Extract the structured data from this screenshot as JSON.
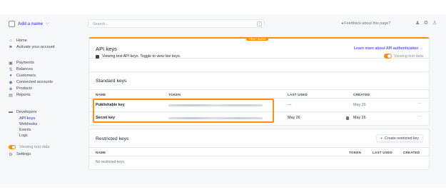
{
  "account": {
    "name": "Add a name",
    "chevron": "chevron-down-icon"
  },
  "sidebar": {
    "items": [
      {
        "label": "Home",
        "icon": "home-icon"
      },
      {
        "label": "Activate your account",
        "icon": "activate-icon"
      },
      {
        "label": "Payments",
        "icon": "payments-icon"
      },
      {
        "label": "Balances",
        "icon": "balances-icon"
      },
      {
        "label": "Customers",
        "icon": "customers-icon"
      },
      {
        "label": "Connected accounts",
        "icon": "connected-accounts-icon"
      },
      {
        "label": "Products",
        "icon": "products-icon"
      },
      {
        "label": "Reports",
        "icon": "reports-icon"
      },
      {
        "label": "Developers",
        "icon": "developers-icon"
      }
    ],
    "developer_sub": [
      "API keys",
      "Webhooks",
      "Events",
      "Logs"
    ],
    "test_toggle_label": "Viewing test data",
    "settings_label": "Settings"
  },
  "header": {
    "search_placeholder": "Search...",
    "search_shortcut": "/",
    "feedback": "Feedback about this page?"
  },
  "api_keys": {
    "badge": "TEST DATA",
    "title": "API keys",
    "learn_more": "Learn more about API authentication →",
    "notice": "Viewing test API keys. Toggle to view live keys.",
    "viewing_test": "Viewing test data"
  },
  "standard_keys": {
    "title": "Standard keys",
    "columns": {
      "name": "NAME",
      "token": "TOKEN",
      "last_used": "LAST USED",
      "created": "CREATED"
    },
    "rows": [
      {
        "name": "Publishable key",
        "last_used": "—",
        "created": "May 26"
      },
      {
        "name": "Secret key",
        "last_used": "May 26",
        "created": "May 26"
      }
    ],
    "more": "···"
  },
  "restricted_keys": {
    "title": "Restricted keys",
    "create_label": "Create restricted key",
    "columns": {
      "name": "NAME",
      "token": "TOKEN",
      "last_used": "LAST USED",
      "created": "CREATED"
    },
    "empty": "No restricted keys"
  },
  "colors": {
    "accent": "#635bff",
    "test_orange": "#ff8f0e"
  }
}
